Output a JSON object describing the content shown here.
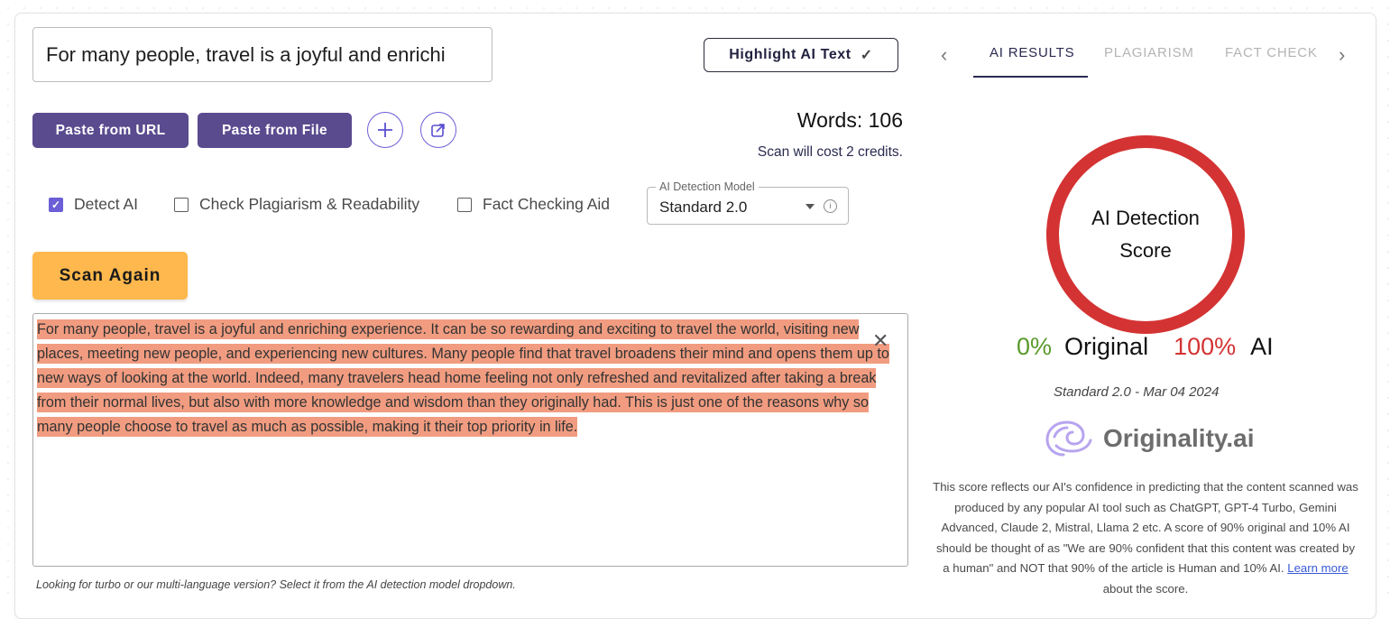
{
  "input": {
    "title_value": "For many people, travel is a joyful and enrichi"
  },
  "toolbar": {
    "highlight_label": "Highlight AI Text",
    "paste_url_label": "Paste from URL",
    "paste_file_label": "Paste from File"
  },
  "stats": {
    "words": "Words: 106",
    "cost": "Scan will cost 2 credits."
  },
  "options": {
    "detect_ai": "Detect AI",
    "check_plagiarism": "Check Plagiarism & Readability",
    "fact_checking": "Fact Checking Aid"
  },
  "model": {
    "label": "AI Detection Model",
    "value": "Standard 2.0"
  },
  "scan": {
    "label": "Scan Again"
  },
  "content": {
    "text": "For many people, travel is a joyful and enriching experience. It can be so rewarding and exciting to travel the world, visiting new places, meeting new people, and experiencing new cultures. Many people find that travel broadens their mind and opens them up to new ways of looking at the world. Indeed, many travelers head home feeling not only refreshed and revitalized after taking a break from their normal lives, but also with more knowledge and wisdom than they originally had. This is just one of the reasons why so many people choose to travel as much as possible, making it their top priority in life."
  },
  "hint": "Looking for turbo or our multi-language version? Select it from the AI detection model dropdown.",
  "tabs": [
    {
      "label": "AI RESULTS"
    },
    {
      "label": "PLAGIARISM"
    },
    {
      "label": "FACT CHECK"
    }
  ],
  "results": {
    "ring_title": "AI Detection Score",
    "original_pct": "0%",
    "original_label": "Original",
    "ai_pct": "100%",
    "ai_label": "AI",
    "stamp": "Standard 2.0 - Mar 04 2024",
    "brand": "Originality.ai",
    "desc_text": "This score reflects our AI's confidence in predicting that the content scanned was produced by any popular AI tool such as ChatGPT, GPT-4 Turbo, Gemini Advanced, Claude 2, Mistral, Llama 2 etc. A score of 90% original and 10% AI should be thought of as \"We are 90% confident that this content was created by a human\" and NOT that 90% of the article is Human and 10% AI.",
    "learn_more": "Learn more",
    "desc_tail": "about the score."
  },
  "colors": {
    "accent": "#5a4b8f",
    "ai_red": "#d43333",
    "original_green": "#5a9a2b",
    "scan": "#ffb84d",
    "highlight": "#f19c80"
  }
}
